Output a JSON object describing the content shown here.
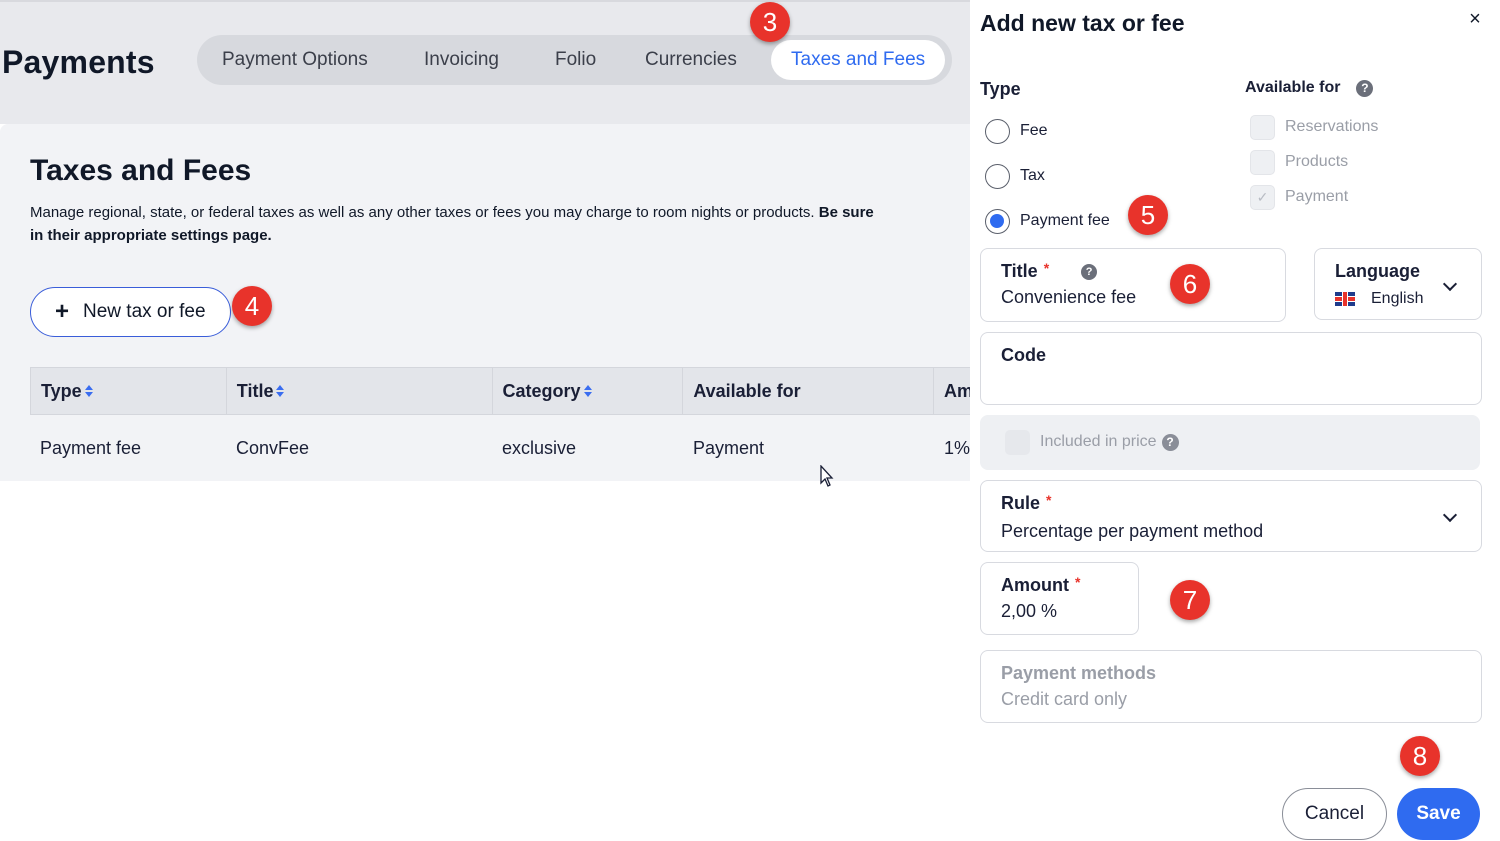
{
  "page": {
    "title": "Payments",
    "tabs": [
      {
        "label": "Payment Options"
      },
      {
        "label": "Invoicing"
      },
      {
        "label": "Folio"
      },
      {
        "label": "Currencies"
      },
      {
        "label": "Taxes and Fees",
        "active": true
      }
    ]
  },
  "section": {
    "title": "Taxes and Fees",
    "description_line1": "Manage regional, state, or federal taxes as well as any other taxes or fees you may charge to room nights or products.",
    "description_bold": "Be sure",
    "description_line2": "in their appropriate settings page.",
    "new_button_icon": "+",
    "new_button_label": "New tax or fee"
  },
  "table": {
    "columns": [
      {
        "label": "Type",
        "sortable": true
      },
      {
        "label": "Title",
        "sortable": true
      },
      {
        "label": "Category",
        "sortable": true
      },
      {
        "label": "Available for",
        "sortable": false
      },
      {
        "label": "Am",
        "sortable": false
      }
    ],
    "rows": [
      [
        "Payment fee",
        "ConvFee",
        "exclusive",
        "Payment",
        "1%"
      ]
    ]
  },
  "drawer": {
    "title": "Add new tax or fee",
    "close_icon": "×",
    "type_label": "Type",
    "type_options": [
      {
        "label": "Fee",
        "checked": false
      },
      {
        "label": "Tax",
        "checked": false
      },
      {
        "label": "Payment fee",
        "checked": true
      }
    ],
    "available_label": "Available for",
    "help_glyph": "?",
    "available_options": [
      {
        "label": "Reservations",
        "checked": false
      },
      {
        "label": "Products",
        "checked": false
      },
      {
        "label": "Payment",
        "checked": true
      }
    ],
    "title_field": {
      "label": "Title",
      "required_mark": "*",
      "value": "Convenience fee"
    },
    "language_field": {
      "label": "Language",
      "value": "English"
    },
    "code_field": {
      "label": "Code",
      "value": ""
    },
    "included_label": "Included in price",
    "rule_field": {
      "label": "Rule",
      "required_mark": "*",
      "value": "Percentage per payment method"
    },
    "amount_field": {
      "label": "Amount",
      "required_mark": "*",
      "value": "2,00 %"
    },
    "payment_methods_field": {
      "label": "Payment methods",
      "value": "Credit card only"
    },
    "cancel_label": "Cancel",
    "save_label": "Save"
  },
  "annotations": [
    "3",
    "4",
    "5",
    "6",
    "7",
    "8"
  ],
  "colors": {
    "accent": "#2f6bf0",
    "badge": "#e8332b",
    "band": "#e8e9ed",
    "panel": "#f2f3f6"
  }
}
